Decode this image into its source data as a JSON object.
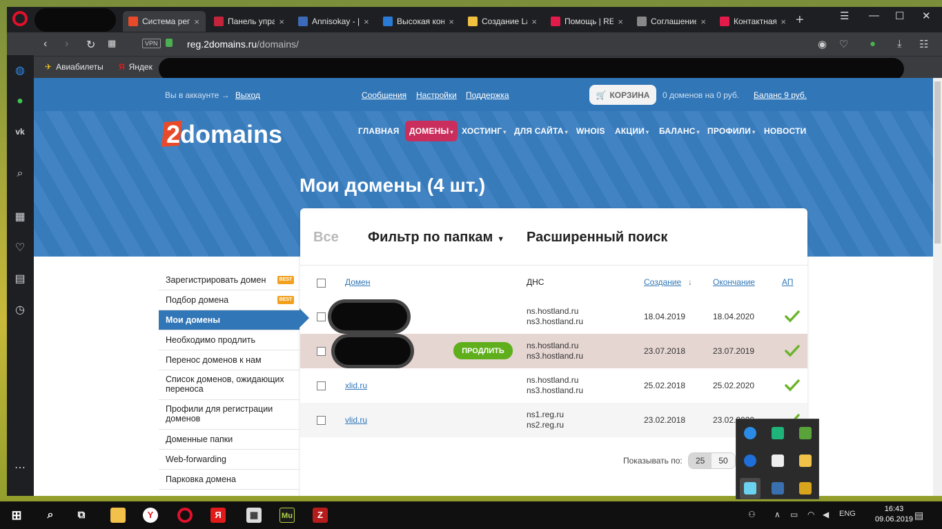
{
  "browser": {
    "tabs": [
      {
        "title": "Система рег",
        "active": true,
        "favicon_color": "#e94b2a"
      },
      {
        "title": "Панель упра",
        "active": false,
        "favicon_color": "#c3243b"
      },
      {
        "title": "Annisokay - |",
        "active": false,
        "favicon_color": "#3d6ab8"
      },
      {
        "title": "Высокая кон",
        "active": false,
        "favicon_color": "#2a7bd6"
      },
      {
        "title": "Создание La",
        "active": false,
        "favicon_color": "#f0c040"
      },
      {
        "title": "Помощь | RE",
        "active": false,
        "favicon_color": "#e11b4a"
      },
      {
        "title": "Соглашение",
        "active": false,
        "favicon_color": "#888888"
      },
      {
        "title": "Контактная",
        "active": false,
        "favicon_color": "#e11b4a"
      }
    ],
    "vpn_label": "VPN",
    "url_host": "reg.2domains.ru",
    "url_path": "/domains/",
    "bookmarks": [
      {
        "label": "Авиабилеты"
      },
      {
        "label": "Яндекс"
      }
    ]
  },
  "site": {
    "account_text": "Вы в аккаунте →",
    "logout": "Выход",
    "links": [
      "Сообщения",
      "Настройки",
      "Поддержка"
    ],
    "cart_label": "КОРЗИНА",
    "cart_summary": "0 доменов на 0 руб.",
    "balance": "Баланс 9 руб.",
    "logo_text": "2domains",
    "nav": [
      {
        "label": "ГЛАВНАЯ",
        "active": false,
        "dropdown": false
      },
      {
        "label": "ДОМЕНЫ",
        "active": true,
        "dropdown": true
      },
      {
        "label": "ХОСТИНГ",
        "active": false,
        "dropdown": true
      },
      {
        "label": "ДЛЯ САЙТА",
        "active": false,
        "dropdown": true
      },
      {
        "label": "WHOIS",
        "active": false,
        "dropdown": false
      },
      {
        "label": "АКЦИИ",
        "active": false,
        "dropdown": true
      },
      {
        "label": "БАЛАНС",
        "active": false,
        "dropdown": true
      },
      {
        "label": "ПРОФИЛИ",
        "active": false,
        "dropdown": true
      },
      {
        "label": "НОВОСТИ",
        "active": false,
        "dropdown": false
      }
    ],
    "page_title": "Мои домены (4 шт.)"
  },
  "filters": {
    "all": "Все",
    "folders": "Фильтр по папкам",
    "advanced": "Расширенный поиск"
  },
  "table": {
    "headers": {
      "domain": "Домен",
      "dns": "ДНС",
      "created": "Создание",
      "sort_arrow": "↓",
      "expires": "Окончание",
      "auto": "АП"
    },
    "renew_label": "ПРОДЛИТЬ",
    "rows": [
      {
        "domain": "",
        "dns1": "ns.hostland.ru",
        "dns2": "ns3.hostland.ru",
        "created": "18.04.2019",
        "expires": "18.04.2020"
      },
      {
        "domain": "",
        "dns1": "ns.hostland.ru",
        "dns2": "ns3.hostland.ru",
        "created": "23.07.2018",
        "expires": "23.07.2019"
      },
      {
        "domain": "xlid.ru",
        "dns1": "ns.hostland.ru",
        "dns2": "ns3.hostland.ru",
        "created": "25.02.2018",
        "expires": "25.02.2020"
      },
      {
        "domain": "vlid.ru",
        "dns1": "ns1.reg.ru",
        "dns2": "ns2.reg.ru",
        "created": "23.02.2018",
        "expires": "23.02.2020"
      }
    ],
    "per_page_label": "Показывать по:",
    "per_page": [
      "25",
      "50"
    ]
  },
  "side_menu": [
    {
      "label": "Зарегистрировать домен",
      "badge": "BEST"
    },
    {
      "label": "Подбор домена",
      "badge": "BEST"
    },
    {
      "label": "Мои домены",
      "active": true
    },
    {
      "label": "Необходимо продлить"
    },
    {
      "label": "Перенос доменов к нам"
    },
    {
      "label": "Список доменов, ожидающих переноса",
      "two_line": true
    },
    {
      "label": "Профили для регистрации доменов",
      "two_line": true
    },
    {
      "label": "Доменные папки"
    },
    {
      "label": "Web-forwarding"
    },
    {
      "label": "Парковка домена"
    }
  ],
  "taskbar": {
    "lang": "ENG",
    "time": "16:43",
    "date": "09.06.2019"
  },
  "colors": {
    "brand_blue": "#3176b7",
    "nav_active": "#c92e5d",
    "renew_green": "#5fae1c",
    "highlight_row": "#e5d6d2"
  }
}
